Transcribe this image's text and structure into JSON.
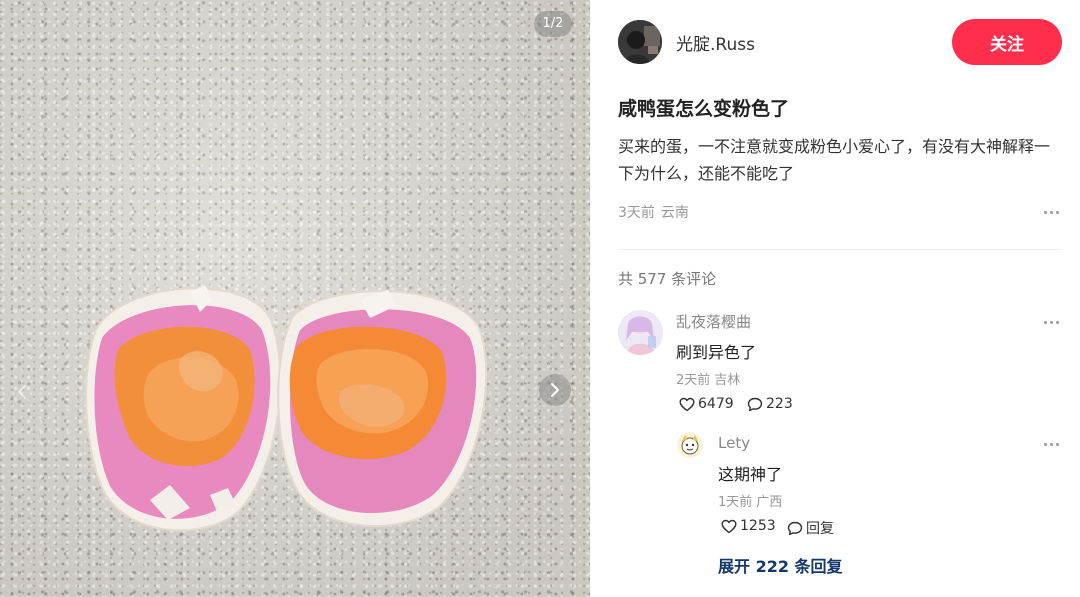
{
  "media": {
    "page_counter": "1/2",
    "prev_icon": "chevron-left-icon",
    "next_icon": "chevron-right-icon"
  },
  "author": {
    "name": "光腚.Russ",
    "follow_label": "关注"
  },
  "post": {
    "title": "咸鸭蛋怎么变粉色了",
    "body": "买来的蛋，一不注意就变成粉色小爱心了，有没有大神解释一下为什么，还能不能吃了",
    "time": "3天前",
    "location": "云南"
  },
  "comments": {
    "count_label": "共 577 条评论",
    "items": [
      {
        "name": "乱夜落樱曲",
        "text": "刷到异色了",
        "time": "2天前",
        "location": "吉林",
        "likes": "6479",
        "replies": "223",
        "sub": {
          "name": "Lety",
          "text": "这期神了",
          "time": "1天前",
          "location": "广西",
          "likes": "1253",
          "reply_label": "回复"
        }
      }
    ],
    "expand_label": "展开 222 条回复"
  },
  "colors": {
    "accent": "#ff2e4d",
    "link": "#13386c",
    "muted": "#999999"
  }
}
